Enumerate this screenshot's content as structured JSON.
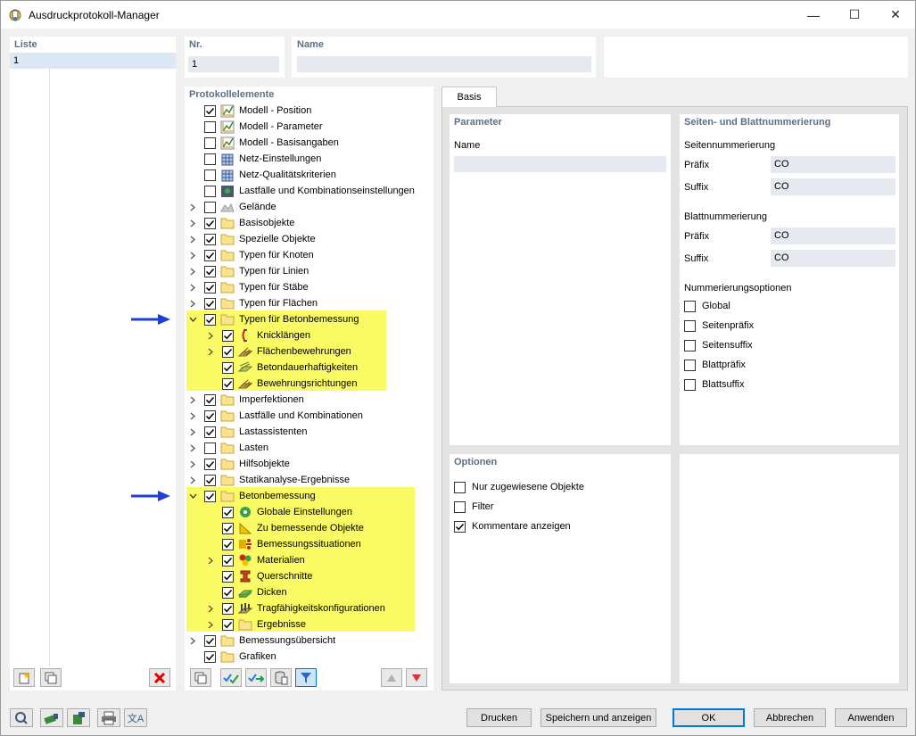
{
  "window": {
    "title": "Ausdruckprotokoll-Manager"
  },
  "list": {
    "header": "Liste",
    "items": [
      "1"
    ]
  },
  "nr": {
    "header": "Nr.",
    "value": "1"
  },
  "name_field": {
    "header": "Name",
    "value": ""
  },
  "tree": {
    "header": "Protokollelemente",
    "rows": [
      {
        "label": "Modell - Position",
        "checked": true,
        "level": 0,
        "expander": "none",
        "icon": "model-icon"
      },
      {
        "label": "Modell - Parameter",
        "checked": false,
        "level": 0,
        "expander": "none",
        "icon": "model-icon"
      },
      {
        "label": "Modell - Basisangaben",
        "checked": false,
        "level": 0,
        "expander": "none",
        "icon": "model-icon"
      },
      {
        "label": "Netz-Einstellungen",
        "checked": false,
        "level": 0,
        "expander": "none",
        "icon": "mesh-icon"
      },
      {
        "label": "Netz-Qualitätskriterien",
        "checked": false,
        "level": 0,
        "expander": "none",
        "icon": "mesh-icon"
      },
      {
        "label": "Lastfälle und Kombinationseinstellungen",
        "checked": false,
        "level": 0,
        "expander": "none",
        "icon": "load-settings-icon"
      },
      {
        "label": "Gelände",
        "checked": false,
        "level": 0,
        "expander": "collapsed",
        "icon": "terrain-icon"
      },
      {
        "label": "Basisobjekte",
        "checked": true,
        "level": 0,
        "expander": "collapsed",
        "icon": "folder-icon"
      },
      {
        "label": "Spezielle Objekte",
        "checked": true,
        "level": 0,
        "expander": "collapsed",
        "icon": "folder-icon"
      },
      {
        "label": "Typen für Knoten",
        "checked": true,
        "level": 0,
        "expander": "collapsed",
        "icon": "folder-icon"
      },
      {
        "label": "Typen für Linien",
        "checked": true,
        "level": 0,
        "expander": "collapsed",
        "icon": "folder-icon"
      },
      {
        "label": "Typen für Stäbe",
        "checked": true,
        "level": 0,
        "expander": "collapsed",
        "icon": "folder-icon"
      },
      {
        "label": "Typen für Flächen",
        "checked": true,
        "level": 0,
        "expander": "collapsed",
        "icon": "folder-icon"
      },
      {
        "label": "Typen für Betonbemessung",
        "checked": true,
        "level": 0,
        "expander": "expanded",
        "icon": "folder-icon"
      },
      {
        "label": "Knicklängen",
        "checked": true,
        "level": 1,
        "expander": "collapsed",
        "icon": "buckling-icon"
      },
      {
        "label": "Flächenbewehrungen",
        "checked": true,
        "level": 1,
        "expander": "collapsed",
        "icon": "reinforcement-icon"
      },
      {
        "label": "Betondauerhaftigkeiten",
        "checked": true,
        "level": 1,
        "expander": "none",
        "icon": "durability-icon"
      },
      {
        "label": "Bewehrungsrichtungen",
        "checked": true,
        "level": 1,
        "expander": "none",
        "icon": "reinforcement-icon"
      },
      {
        "label": "Imperfektionen",
        "checked": true,
        "level": 0,
        "expander": "collapsed",
        "icon": "folder-icon"
      },
      {
        "label": "Lastfälle und Kombinationen",
        "checked": true,
        "level": 0,
        "expander": "collapsed",
        "icon": "folder-icon"
      },
      {
        "label": "Lastassistenten",
        "checked": true,
        "level": 0,
        "expander": "collapsed",
        "icon": "folder-icon"
      },
      {
        "label": "Lasten",
        "checked": false,
        "level": 0,
        "expander": "collapsed",
        "icon": "folder-icon"
      },
      {
        "label": "Hilfsobjekte",
        "checked": true,
        "level": 0,
        "expander": "collapsed",
        "icon": "folder-icon"
      },
      {
        "label": "Statikanalyse-Ergebnisse",
        "checked": true,
        "level": 0,
        "expander": "collapsed",
        "icon": "folder-icon"
      },
      {
        "label": "Betonbemessung",
        "checked": true,
        "level": 0,
        "expander": "expanded",
        "icon": "folder-icon"
      },
      {
        "label": "Globale Einstellungen",
        "checked": true,
        "level": 1,
        "expander": "none",
        "icon": "global-settings-icon"
      },
      {
        "label": "Zu bemessende Objekte",
        "checked": true,
        "level": 1,
        "expander": "none",
        "icon": "design-objects-icon"
      },
      {
        "label": "Bemessungssituationen",
        "checked": true,
        "level": 1,
        "expander": "none",
        "icon": "design-situations-icon"
      },
      {
        "label": "Materialien",
        "checked": true,
        "level": 1,
        "expander": "collapsed",
        "icon": "materials-icon"
      },
      {
        "label": "Querschnitte",
        "checked": true,
        "level": 1,
        "expander": "none",
        "icon": "cross-section-icon"
      },
      {
        "label": "Dicken",
        "checked": true,
        "level": 1,
        "expander": "none",
        "icon": "thickness-icon"
      },
      {
        "label": "Tragfähigkeitskonfigurationen",
        "checked": true,
        "level": 1,
        "expander": "collapsed",
        "icon": "uls-config-icon"
      },
      {
        "label": "Ergebnisse",
        "checked": true,
        "level": 1,
        "expander": "collapsed",
        "icon": "folder-icon"
      },
      {
        "label": "Bemessungsübersicht",
        "checked": true,
        "level": 0,
        "expander": "collapsed",
        "icon": "folder-icon"
      },
      {
        "label": "Grafiken",
        "checked": true,
        "level": 0,
        "expander": "none",
        "icon": "folder-icon"
      }
    ]
  },
  "tab": {
    "label": "Basis"
  },
  "parameter": {
    "header": "Parameter",
    "name_label": "Name",
    "name_value": ""
  },
  "numbering": {
    "header": "Seiten- und Blattnummerierung",
    "page_header": "Seitennummerierung",
    "page_prefix_label": "Präfix",
    "page_prefix_value": "CO",
    "page_suffix_label": "Suffix",
    "page_suffix_value": "CO",
    "sheet_header": "Blattnummerierung",
    "sheet_prefix_label": "Präfix",
    "sheet_prefix_value": "CO",
    "sheet_suffix_label": "Suffix",
    "sheet_suffix_value": "CO",
    "options_header": "Nummerierungsoptionen",
    "options": [
      {
        "label": "Global",
        "checked": false
      },
      {
        "label": "Seitenpräfix",
        "checked": false
      },
      {
        "label": "Seitensuffix",
        "checked": false
      },
      {
        "label": "Blattpräfix",
        "checked": false
      },
      {
        "label": "Blattsuffix",
        "checked": false
      }
    ]
  },
  "options": {
    "header": "Optionen",
    "items": [
      {
        "label": "Nur zugewiesene Objekte",
        "checked": false
      },
      {
        "label": "Filter",
        "checked": false
      },
      {
        "label": "Kommentare anzeigen",
        "checked": true
      }
    ]
  },
  "buttons": {
    "print": "Drucken",
    "save_show": "Speichern und anzeigen",
    "ok": "OK",
    "cancel": "Abbrechen",
    "apply": "Anwenden"
  },
  "colors": {
    "highlight": "#fafa64",
    "header": "#5b6f86",
    "arrow": "#1f3fd8",
    "field": "#e6e9f0"
  }
}
